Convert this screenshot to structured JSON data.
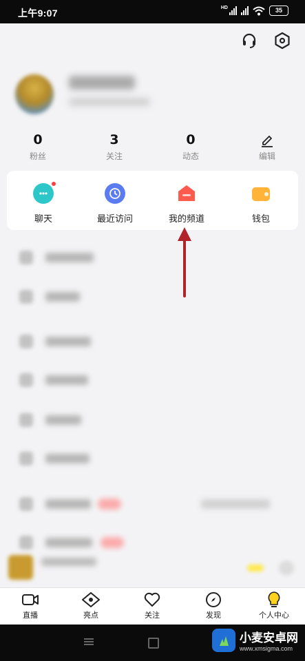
{
  "status_bar": {
    "time": "上午9:07",
    "battery": "35",
    "network": "HD"
  },
  "top_icons": [
    "headset-icon",
    "settings-hexagon-icon"
  ],
  "stats": [
    {
      "num": "0",
      "label": "粉丝"
    },
    {
      "num": "3",
      "label": "关注"
    },
    {
      "num": "0",
      "label": "动态"
    },
    {
      "num": "",
      "label": "编辑"
    }
  ],
  "quick_actions": [
    {
      "label": "聊天",
      "icon": "chat-icon",
      "color": "#2ec7c9"
    },
    {
      "label": "最近访问",
      "icon": "clock-icon",
      "color": "#5b7cf0"
    },
    {
      "label": "我的频道",
      "icon": "channel-house-icon",
      "color": "#ff5a4e"
    },
    {
      "label": "钱包",
      "icon": "wallet-icon",
      "color": "#ffb338"
    }
  ],
  "tabs": [
    {
      "label": "直播",
      "icon": "video-camera-icon"
    },
    {
      "label": "亮点",
      "icon": "eye-icon"
    },
    {
      "label": "关注",
      "icon": "heart-icon"
    },
    {
      "label": "发现",
      "icon": "compass-icon"
    },
    {
      "label": "个人中心",
      "icon": "person-bulb-icon"
    }
  ],
  "watermark": {
    "title": "小麦安卓网",
    "url": "www.xmsigma.com"
  },
  "colors": {
    "accent_yellow": "#ffd21f",
    "arrow": "#b0232a"
  }
}
